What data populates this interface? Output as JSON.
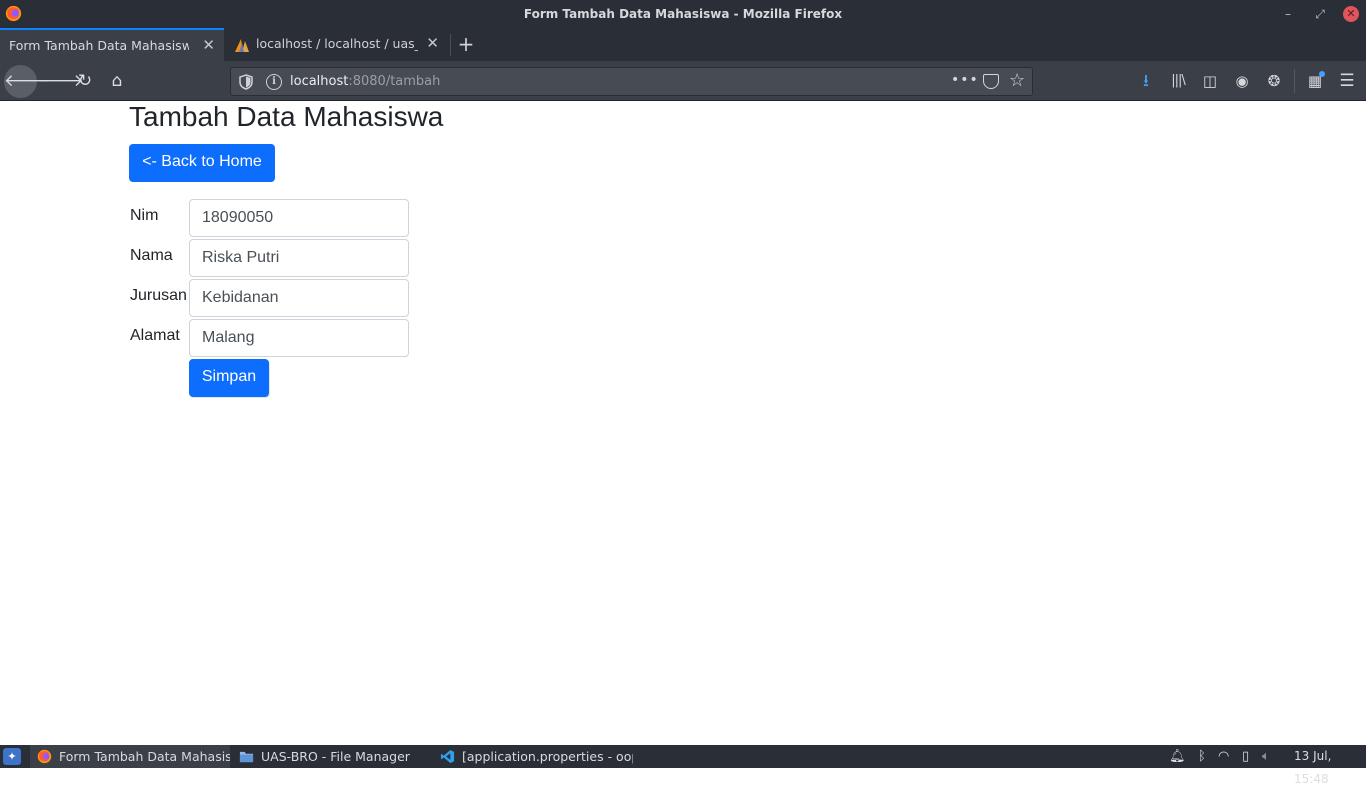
{
  "window": {
    "title": "Form Tambah Data Mahasiswa - Mozilla Firefox",
    "controls": {
      "minimize": "–",
      "maximize": "⤢",
      "close": "✕"
    }
  },
  "tabs": [
    {
      "label": "Form Tambah Data Mahasiswa",
      "active": true,
      "icon": "none"
    },
    {
      "label": "localhost / localhost / uas_oop",
      "active": false,
      "icon": "phpmyadmin-sail-icon"
    }
  ],
  "toolbar": {
    "url_host": "localhost",
    "url_rest": ":8080/tambah",
    "page_actions": "•••",
    "icons": [
      "back-arrow-icon",
      "forward-arrow-icon",
      "reload-icon",
      "home-icon",
      "shield-icon",
      "info-icon",
      "pocket-icon",
      "star-icon",
      "download-icon",
      "library-icon",
      "sidebar-icon",
      "account-icon",
      "cookie-icon",
      "gift-icon",
      "hamburger-menu-icon"
    ],
    "accent": "#0a84ff",
    "download_color": "#45a1ff"
  },
  "page": {
    "heading": "Tambah Data Mahasiswa",
    "back_button": "<- Back to Home",
    "form": {
      "nim": {
        "label": "Nim",
        "value": "18090050"
      },
      "nama": {
        "label": "Nama",
        "value": "Riska Putri"
      },
      "jurusan": {
        "label": "Jurusan",
        "value": "Kebidanan"
      },
      "alamat": {
        "label": "Alamat",
        "value": "Malang"
      }
    },
    "submit_button": "Simpan",
    "primary_color": "#0d6efd"
  },
  "taskbar": {
    "tasks": [
      {
        "label": "Form Tambah Data Mahasis...",
        "icon": "firefox-icon",
        "active": true
      },
      {
        "label": "UAS-BRO - File Manager",
        "icon": "folder-icon",
        "active": false
      },
      {
        "label": "[application.properties - oop...",
        "icon": "vscode-icon",
        "active": false
      }
    ],
    "clock": "13 Jul, 15:48"
  }
}
